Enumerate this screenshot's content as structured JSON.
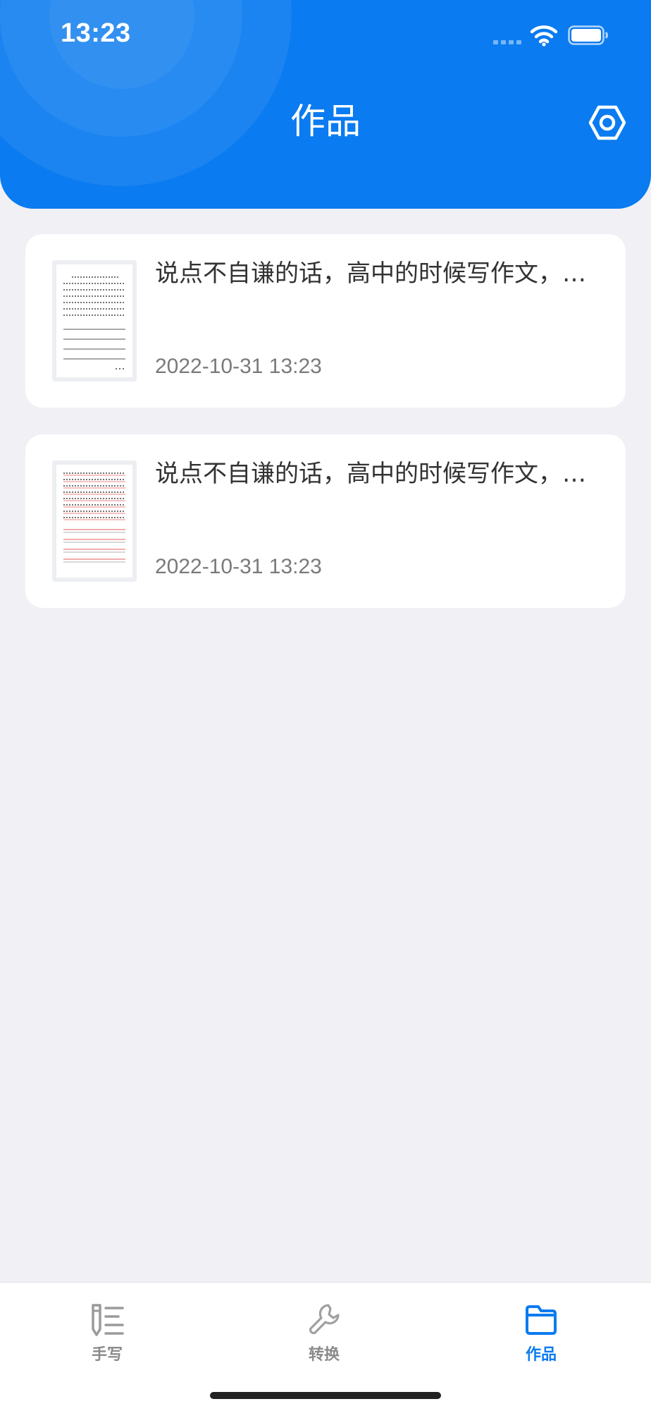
{
  "status_bar": {
    "time": "13:23"
  },
  "header": {
    "title": "作品",
    "background_color": "#0a7bf0",
    "settings_icon": "hexagon-settings-icon"
  },
  "works": [
    {
      "title": "说点不自谦的话，高中的时候写作文，我基本没有低于四十分的时候，这是因为我高二高三",
      "date": "2022-10-31 13:23",
      "thumbnail_icon": "document-thumbnail-black-lines"
    },
    {
      "title": "说点不自谦的话，高中的时候写作文，我基本没有低于四十分的时候，这是因为我高二高三",
      "date": "2022-10-31 13:23",
      "thumbnail_icon": "document-thumbnail-red-lines"
    }
  ],
  "tab_bar": {
    "tabs": [
      {
        "label": "手写",
        "icon": "handwriting-icon",
        "active": false
      },
      {
        "label": "转换",
        "icon": "wrench-icon",
        "active": false
      },
      {
        "label": "作品",
        "icon": "folder-icon",
        "active": true
      }
    ],
    "active_color": "#0a7bf0",
    "inactive_color": "#8a8a8a"
  }
}
